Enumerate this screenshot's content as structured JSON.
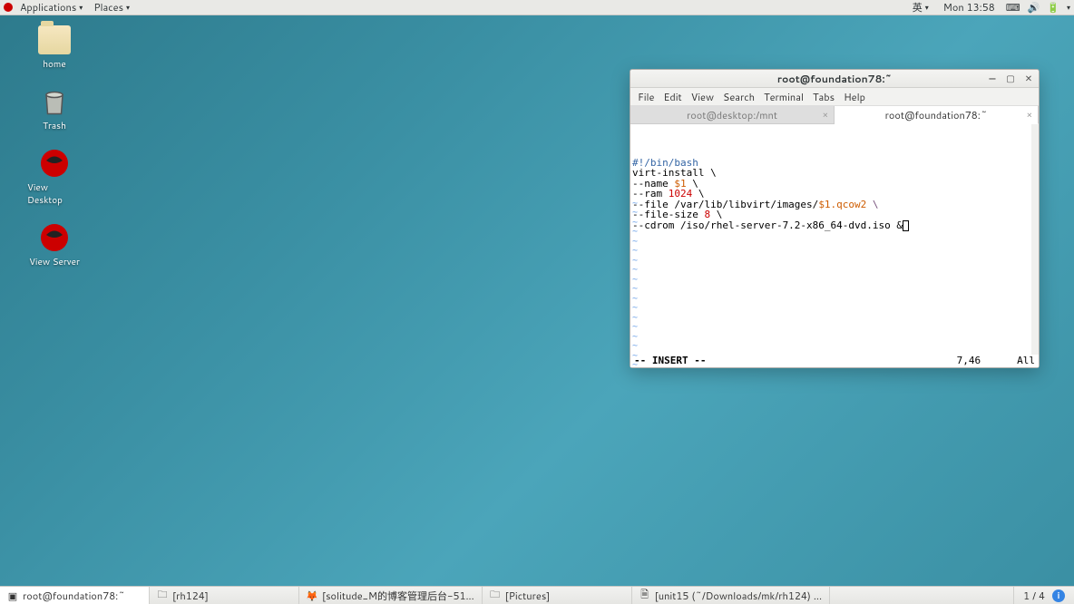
{
  "topbar": {
    "applications": "Applications",
    "places": "Places",
    "ime": "英",
    "clock": "Mon 13:58"
  },
  "desktop_icons": [
    {
      "id": "home",
      "label": "home",
      "type": "folder"
    },
    {
      "id": "trash",
      "label": "Trash",
      "type": "trash"
    },
    {
      "id": "view-desktop",
      "label": "View Desktop",
      "type": "redhat"
    },
    {
      "id": "view-server",
      "label": "View Server",
      "type": "redhat"
    }
  ],
  "terminal": {
    "title": "root@foundation78:~",
    "menus": [
      "File",
      "Edit",
      "View",
      "Search",
      "Terminal",
      "Tabs",
      "Help"
    ],
    "tabs": [
      {
        "label": "root@desktop:/mnt",
        "active": false
      },
      {
        "label": "root@foundation78:~",
        "active": true
      }
    ],
    "lines": [
      {
        "segments": [
          {
            "t": "#!/bin/bash",
            "c": "c-blue"
          }
        ]
      },
      {
        "segments": [
          {
            "t": "virt-install \\"
          }
        ]
      },
      {
        "segments": [
          {
            "t": "--name "
          },
          {
            "t": "$1",
            "c": "c-orange"
          },
          {
            "t": " \\"
          }
        ]
      },
      {
        "segments": [
          {
            "t": "--ram "
          },
          {
            "t": "1024",
            "c": "c-red"
          },
          {
            "t": " \\"
          }
        ]
      },
      {
        "segments": [
          {
            "t": "--file /var/lib/libvirt/images/"
          },
          {
            "t": "$1.qcow2",
            "c": "c-orange"
          },
          {
            "t": " \\",
            "c": "c-purple"
          }
        ]
      },
      {
        "segments": [
          {
            "t": "--file-size "
          },
          {
            "t": "8",
            "c": "c-red"
          },
          {
            "t": " \\"
          }
        ]
      },
      {
        "segments": [
          {
            "t": "--cdrom /iso/rhel-server-7.2-x86_64-dvd.iso &"
          }
        ],
        "cursor": true
      }
    ],
    "status_mode": "-- INSERT --",
    "status_pos": "7,46",
    "status_all": "All"
  },
  "taskbar": {
    "items": [
      {
        "icon": "terminal",
        "label": "root@foundation78:~",
        "active": true
      },
      {
        "icon": "file",
        "label": "[rh124]"
      },
      {
        "icon": "firefox",
        "label": "[solitude_M的博客管理后台-51..."
      },
      {
        "icon": "file",
        "label": "[Pictures]"
      },
      {
        "icon": "doc",
        "label": "[unit15 (~/Downloads/mk/rh124) ..."
      }
    ],
    "workspace": "1 / 4"
  }
}
